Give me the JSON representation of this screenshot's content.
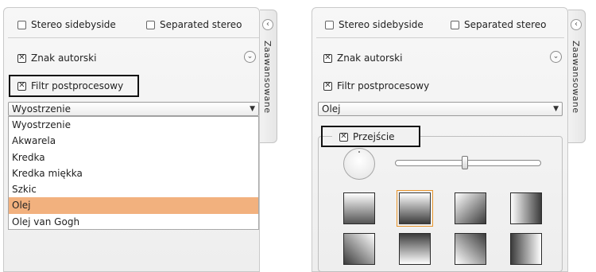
{
  "left": {
    "stereo_sidebyside": "Stereo sidebyside",
    "separated_stereo": "Separated stereo",
    "watermark": "Znak autorski",
    "postprocess": "Filtr postprocesowy",
    "select_value": "Wyostrzenie",
    "dropdown_options": [
      "Wyostrzenie",
      "Akwarela",
      "Kredka",
      "Kredka miękka",
      "Szkic",
      "Olej",
      "Olej van Gogh"
    ],
    "selected_option": "Olej",
    "tab_label": "Zaawansowane"
  },
  "right": {
    "stereo_sidebyside": "Stereo sidebyside",
    "separated_stereo": "Separated stereo",
    "watermark": "Znak autorski",
    "postprocess": "Filtr postprocesowy",
    "select_value": "Olej",
    "transition": "Przejście",
    "tab_label": "Zaawansowane",
    "slider_value": 0.48
  },
  "icons": {
    "chevron_left": "‹",
    "chevron_down": "⌄",
    "select_arrow": "▼"
  }
}
